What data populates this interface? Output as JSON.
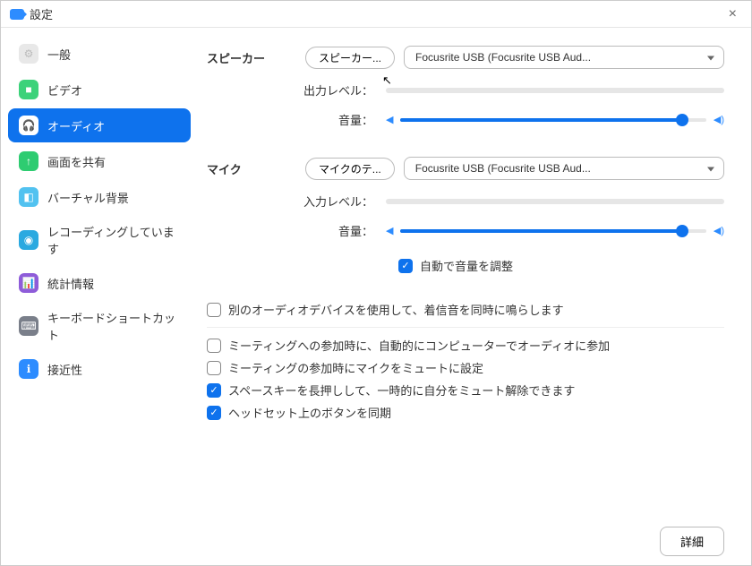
{
  "titlebar": {
    "title": "設定"
  },
  "sidebar": {
    "items": [
      {
        "label": "一般",
        "icon_bg": "#e8e8e8",
        "icon_fg": "#bbb",
        "glyph": "⚙"
      },
      {
        "label": "ビデオ",
        "icon_bg": "#3cd27a",
        "icon_fg": "#fff",
        "glyph": "■"
      },
      {
        "label": "オーディオ",
        "icon_bg": "#ffffff",
        "icon_fg": "#0e72ed",
        "glyph": "🎧",
        "active": true
      },
      {
        "label": "画面を共有",
        "icon_bg": "#2ecc71",
        "icon_fg": "#fff",
        "glyph": "↑"
      },
      {
        "label": "バーチャル背景",
        "icon_bg": "#52c2f0",
        "icon_fg": "#fff",
        "glyph": "◧"
      },
      {
        "label": "レコーディングしています",
        "icon_bg": "#2aa9e0",
        "icon_fg": "#fff",
        "glyph": "◉"
      },
      {
        "label": "統計情報",
        "icon_bg": "#8e5cd9",
        "icon_fg": "#fff",
        "glyph": "📊"
      },
      {
        "label": "キーボードショートカット",
        "icon_bg": "#7a7f8a",
        "icon_fg": "#fff",
        "glyph": "⌨"
      },
      {
        "label": "接近性",
        "icon_bg": "#2d8cff",
        "icon_fg": "#fff",
        "glyph": "ℹ"
      }
    ]
  },
  "speaker": {
    "label": "スピーカー",
    "test_button": "スピーカー...",
    "device": "Focusrite USB (Focusrite USB Aud...",
    "output_level_label": "出力レベル：",
    "volume_label": "音量：",
    "volume_pct": 92
  },
  "mic": {
    "label": "マイク",
    "test_button": "マイクのテ...",
    "device": "Focusrite USB (Focusrite USB Aud...",
    "input_level_label": "入力レベル：",
    "volume_label": "音量：",
    "volume_pct": 92,
    "auto_adjust": {
      "label": "自動で音量を調整",
      "checked": true
    }
  },
  "options": {
    "ring_separate": {
      "label": "別のオーディオデバイスを使用して、着信音を同時に鳴らします",
      "checked": false
    },
    "auto_join_audio": {
      "label": "ミーティングへの参加時に、自動的にコンピューターでオーディオに参加",
      "checked": false
    },
    "mute_on_join": {
      "label": "ミーティングの参加時にマイクをミュートに設定",
      "checked": false
    },
    "push_to_talk": {
      "label": "スペースキーを長押しして、一時的に自分をミュート解除できます",
      "checked": true
    },
    "sync_headset": {
      "label": "ヘッドセット上のボタンを同期",
      "checked": true
    }
  },
  "footer": {
    "details": "詳細"
  }
}
